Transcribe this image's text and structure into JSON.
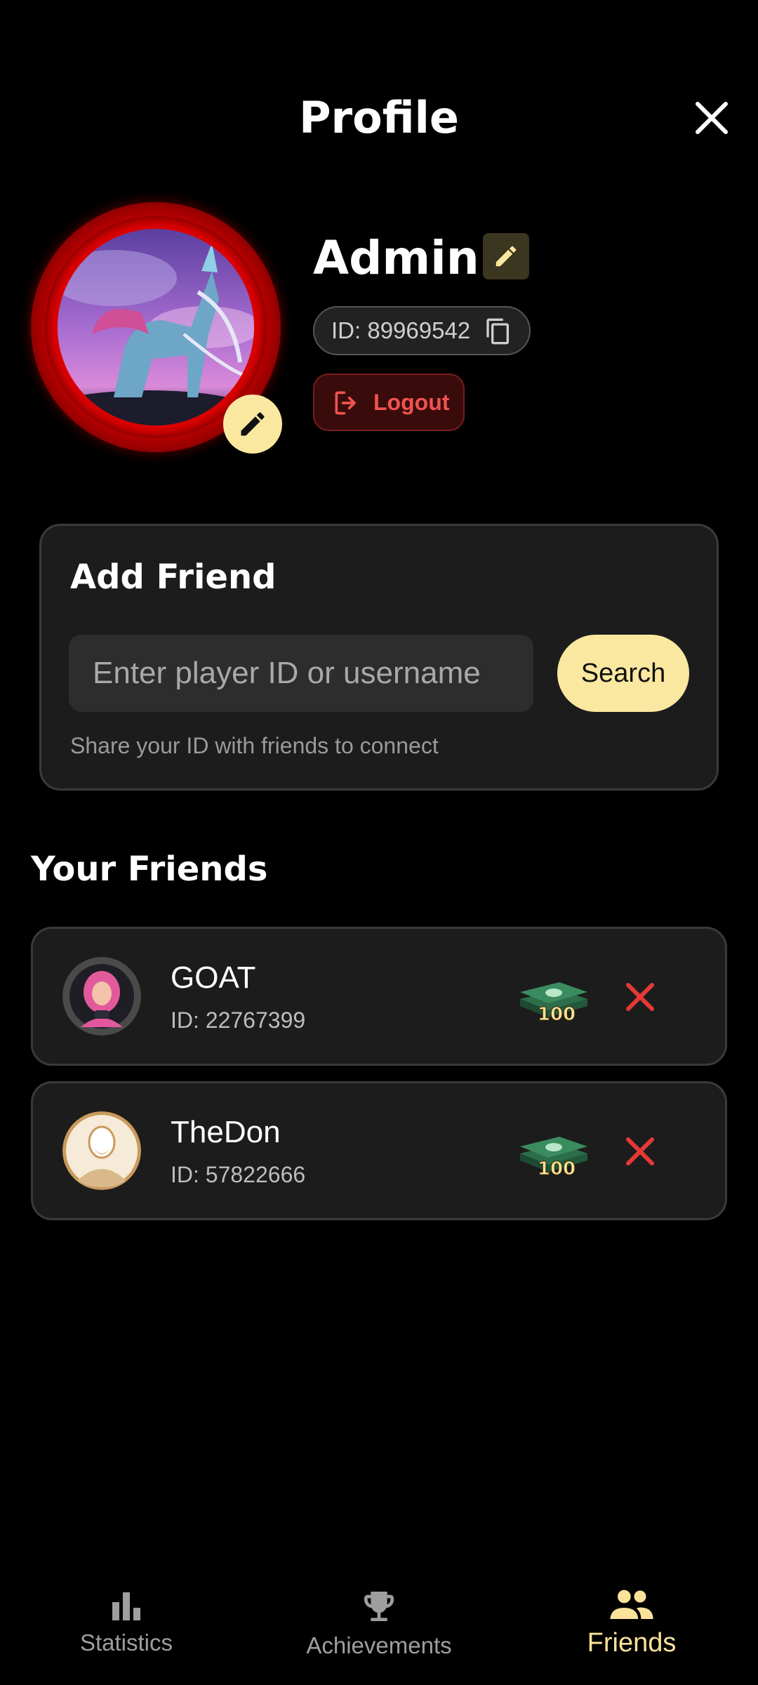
{
  "header": {
    "title": "Profile"
  },
  "profile": {
    "username": "Admin",
    "id_text": "ID: 89969542",
    "logout_label": "Logout"
  },
  "add_friend": {
    "title": "Add Friend",
    "placeholder": "Enter player ID or username",
    "search_label": "Search",
    "hint": "Share your ID with friends to connect"
  },
  "friends": {
    "title": "Your Friends",
    "items": [
      {
        "name": "GOAT",
        "id_text": "ID: 22767399",
        "gift_amount": "100"
      },
      {
        "name": "TheDon",
        "id_text": "ID: 57822666",
        "gift_amount": "100"
      }
    ]
  },
  "bottom_nav": {
    "items": [
      {
        "label": "Statistics",
        "icon": "bar-chart-icon"
      },
      {
        "label": "Achievements",
        "icon": "trophy-icon"
      },
      {
        "label": "Friends",
        "icon": "people-icon",
        "active": true
      }
    ]
  },
  "colors": {
    "background": "#000000",
    "accent": "#fbe8a0",
    "danger": "#ef5350",
    "card": "#1c1c1c"
  }
}
